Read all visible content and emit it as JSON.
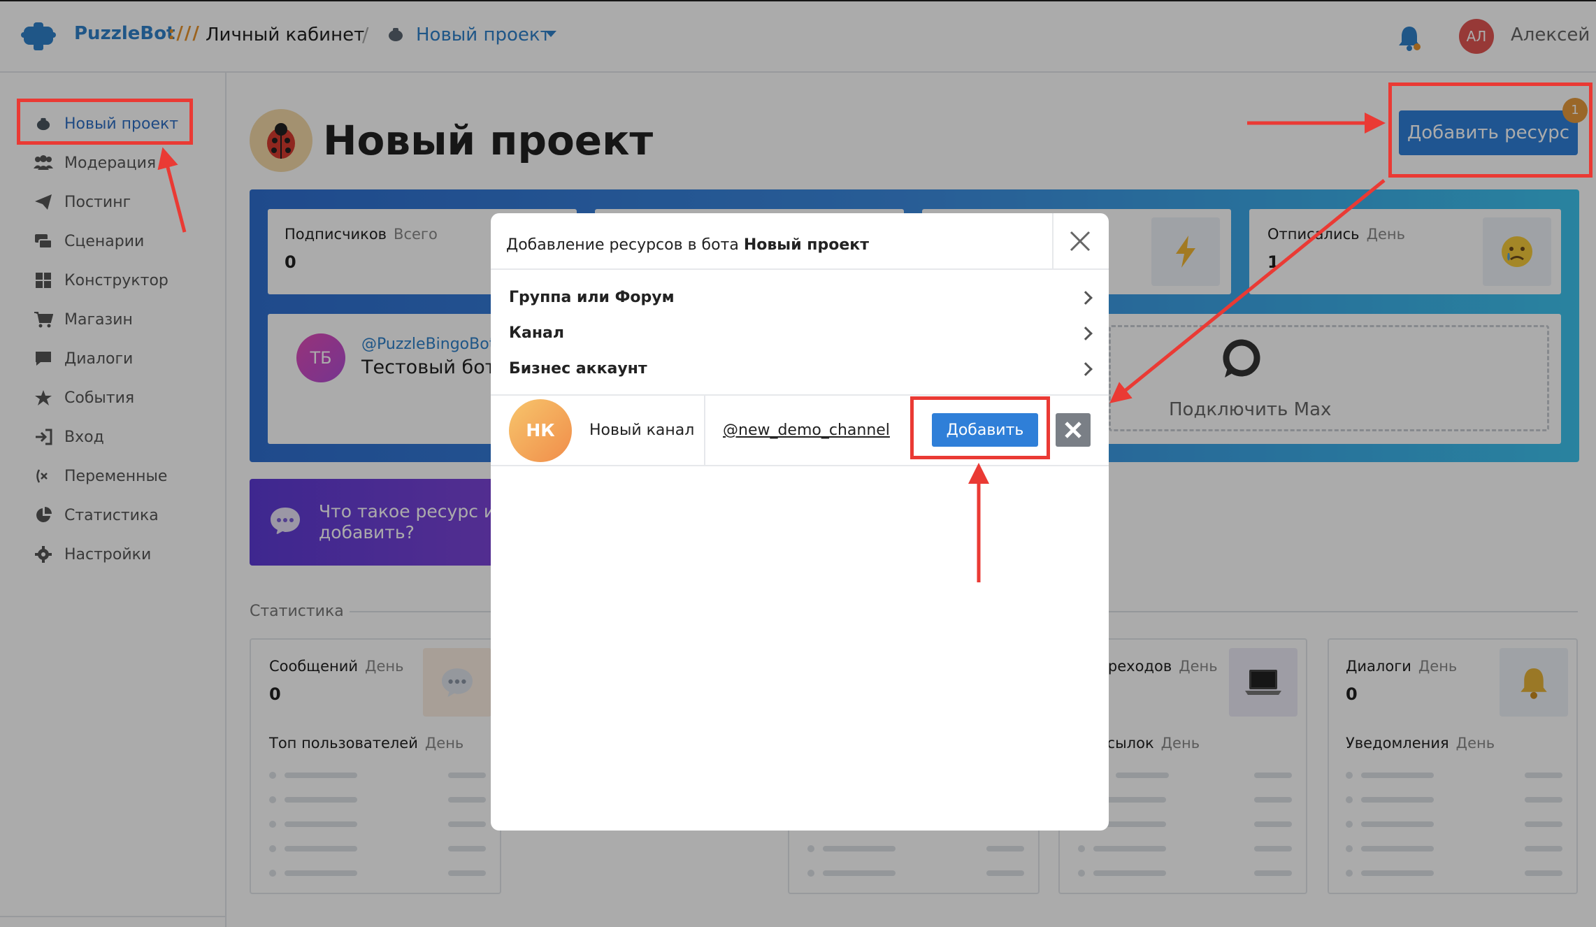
{
  "header": {
    "brand": "PuzzleBot",
    "brand_sep": ":///",
    "cabinet": "Личный кабинет",
    "slash": "/",
    "project": "Новый проект",
    "user_initials": "АЛ",
    "username": "Алексей"
  },
  "sidebar": {
    "items": [
      {
        "label": "Новый проект",
        "icon": "pot-icon"
      },
      {
        "label": "Модерация",
        "icon": "users-icon"
      },
      {
        "label": "Постинг",
        "icon": "paper-plane-icon"
      },
      {
        "label": "Сценарии",
        "icon": "scenario-icon"
      },
      {
        "label": "Конструктор",
        "icon": "grid-icon"
      },
      {
        "label": "Магазин",
        "icon": "cart-icon"
      },
      {
        "label": "Диалоги",
        "icon": "chat-icon"
      },
      {
        "label": "События",
        "icon": "star-icon"
      },
      {
        "label": "Вход",
        "icon": "login-icon"
      },
      {
        "label": "Переменные",
        "icon": "variable-icon"
      },
      {
        "label": "Статистика",
        "icon": "pie-chart-icon"
      },
      {
        "label": "Настройки",
        "icon": "gear-icon"
      }
    ]
  },
  "page": {
    "title": "Новый проект",
    "add_resource": "Добавить ресурс",
    "add_resource_badge": "1"
  },
  "cards": {
    "subscribers": {
      "label": "Подписчиков",
      "period": "Всего",
      "value": "0"
    },
    "unsubscribed": {
      "label": "Отписались",
      "period": "День",
      "value": "1"
    }
  },
  "bot": {
    "initials": "ТБ",
    "handle": "@PuzzleBingoBot",
    "name": "Тестовый бот"
  },
  "connect_max": {
    "label": "Подключить Max"
  },
  "help": {
    "text": "Что такое ресурс и как его добавить?"
  },
  "stats": {
    "heading": "Статистика",
    "messages": {
      "label": "Сообщений",
      "period": "День",
      "value": "0"
    },
    "top_users": {
      "label": "Топ пользователей",
      "period": "День"
    },
    "transitions": {
      "label": "ереходов",
      "period": "День"
    },
    "links": {
      "label": "ссылок",
      "period": "День"
    },
    "dialogs": {
      "label": "Диалоги",
      "period": "День",
      "value": "0"
    },
    "notifications": {
      "label": "Уведомления",
      "period": "День"
    }
  },
  "modal": {
    "title_prefix": "Добавление ресурсов в бота",
    "title_bold": "Новый проект",
    "options": [
      "Группа или Форум",
      "Канал",
      "Бизнес аккаунт"
    ],
    "channel": {
      "initials": "НК",
      "name": "Новый канал",
      "handle": "@new_demo_channel",
      "add_label": "Добавить"
    }
  },
  "colors": {
    "accent": "#2f7fd8",
    "annotation": "#ea3a34",
    "brand_orange": "#e8932c"
  }
}
